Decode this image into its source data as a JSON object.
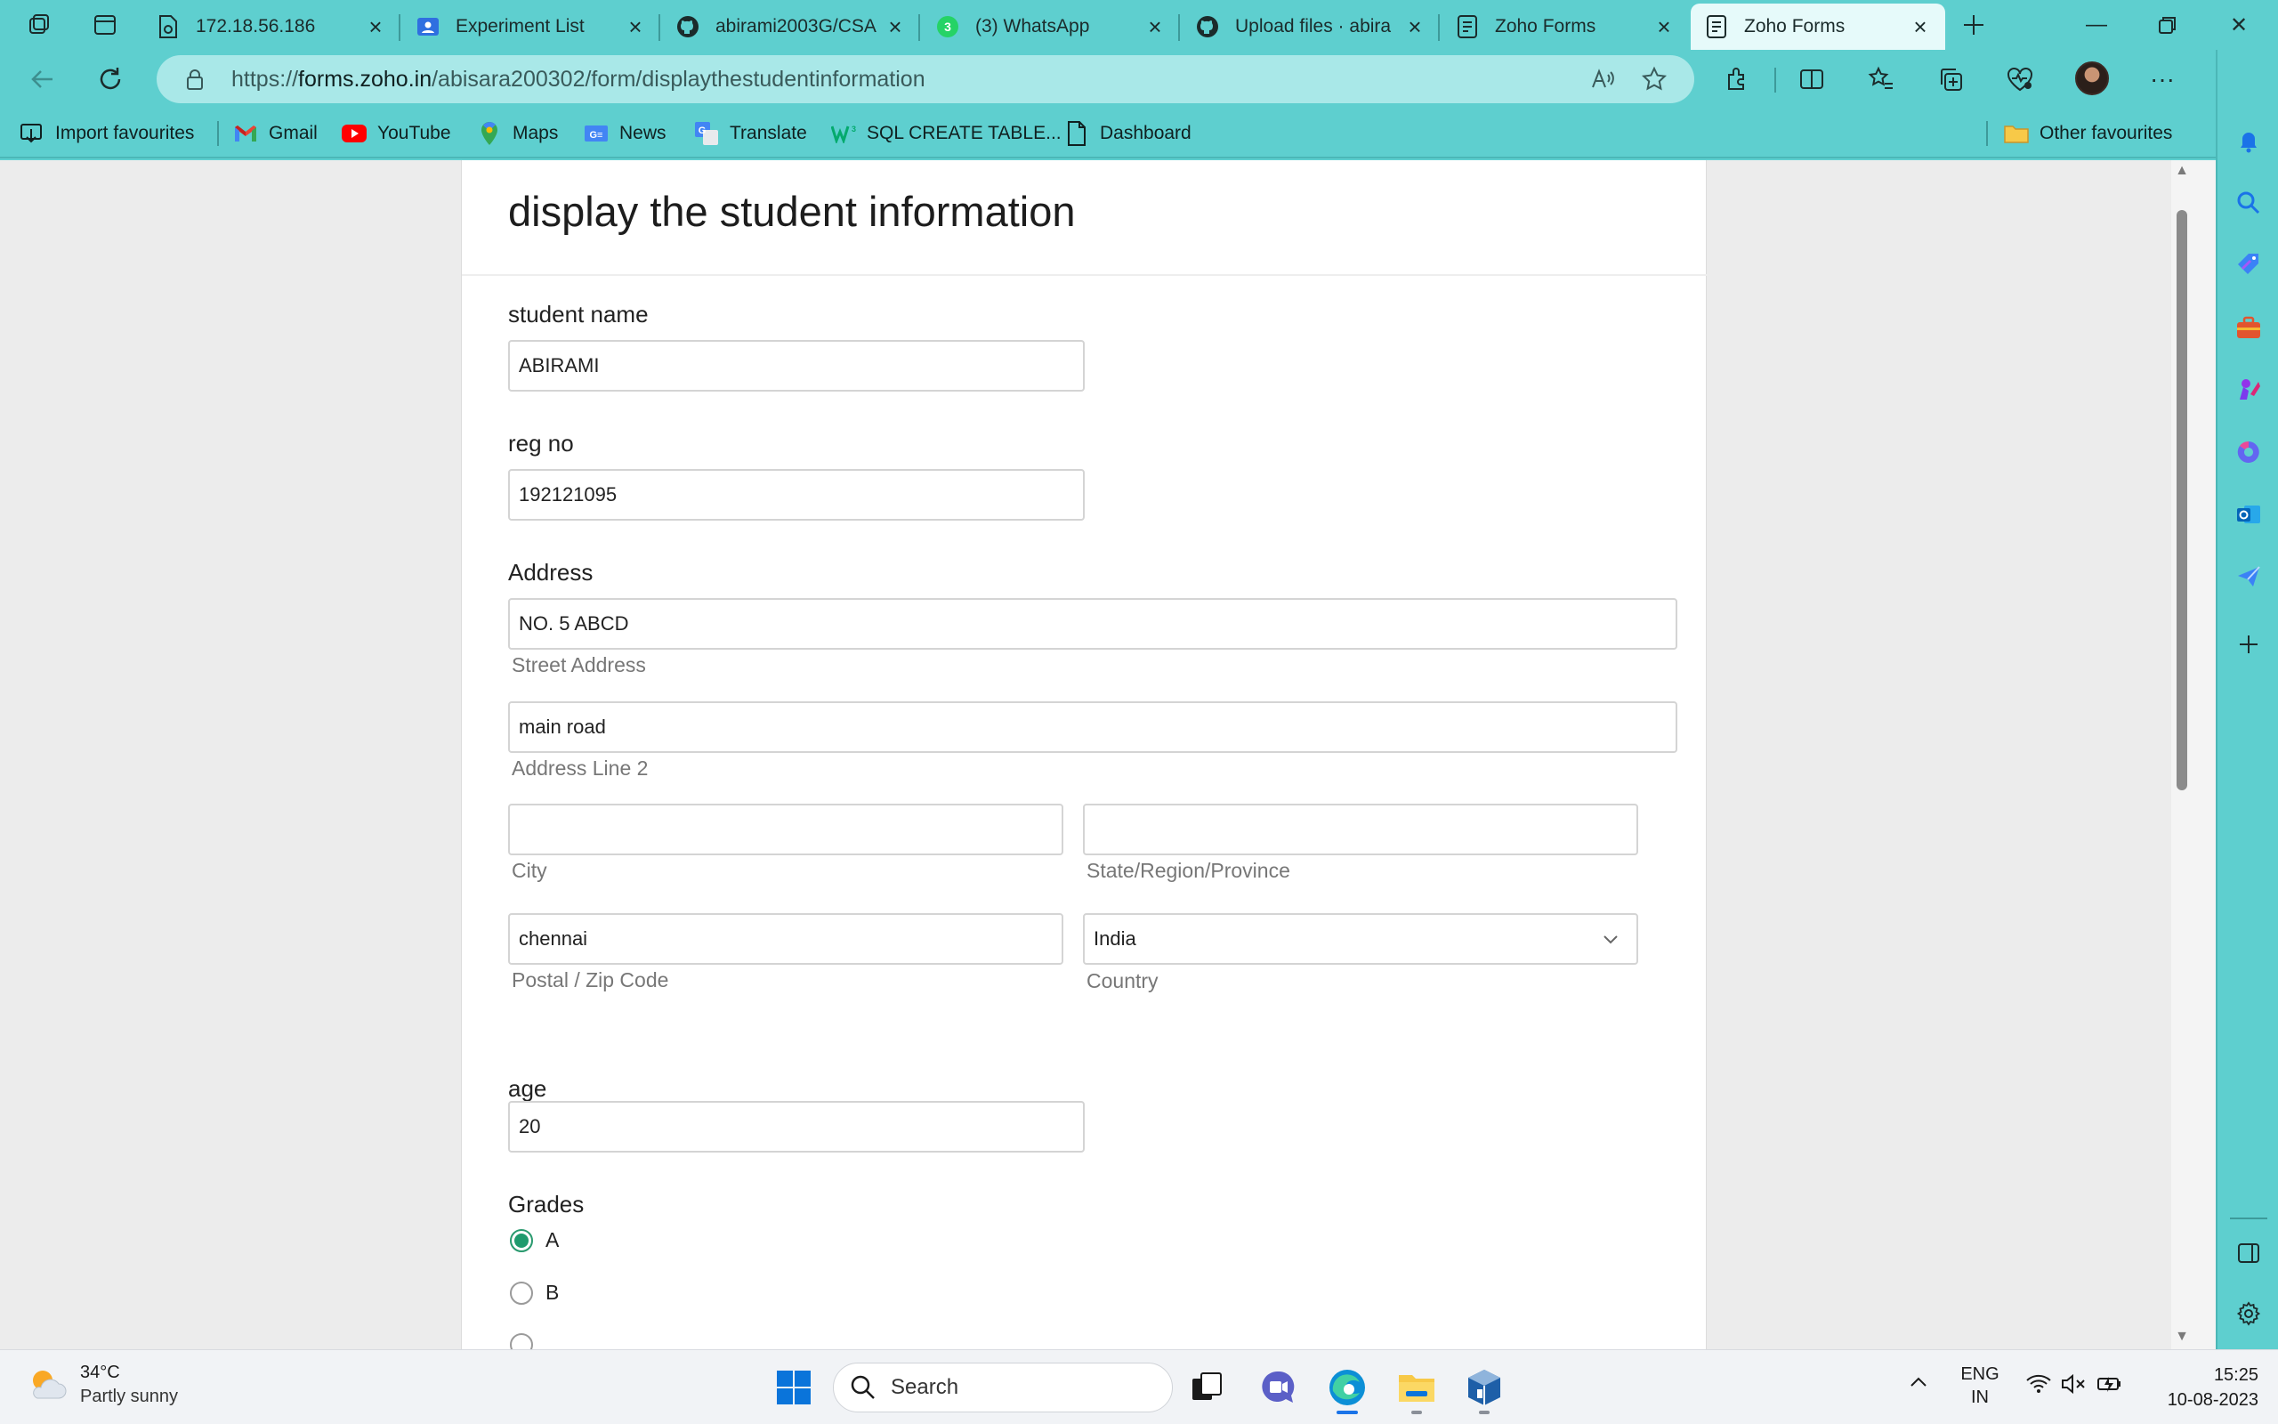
{
  "browser": {
    "tabs": [
      {
        "title": "172.18.56.186",
        "favicon": "document-gear-icon"
      },
      {
        "title": "Experiment List",
        "favicon": "google-classroom-icon"
      },
      {
        "title": "abirami2003G/CSA",
        "favicon": "github-icon"
      },
      {
        "title": "(3) WhatsApp",
        "favicon": "whatsapp-icon"
      },
      {
        "title": "Upload files · abira",
        "favicon": "github-icon"
      },
      {
        "title": "Zoho Forms",
        "favicon": "zoho-forms-icon"
      },
      {
        "title": "Zoho Forms",
        "favicon": "zoho-forms-icon",
        "active": true
      }
    ],
    "url": {
      "prefix": "https://",
      "host": "forms.zoho.in",
      "path": "/abisara200302/form/displaythestudentinformation"
    },
    "favourites": [
      {
        "label": "Import favourites",
        "icon": "import-icon"
      },
      {
        "label": "Gmail",
        "icon": "gmail-icon"
      },
      {
        "label": "YouTube",
        "icon": "youtube-icon"
      },
      {
        "label": "Maps",
        "icon": "maps-icon"
      },
      {
        "label": "News",
        "icon": "news-icon"
      },
      {
        "label": "Translate",
        "icon": "translate-icon"
      },
      {
        "label": "SQL CREATE TABLE...",
        "icon": "w3schools-icon"
      },
      {
        "label": "Dashboard",
        "icon": "page-icon"
      }
    ],
    "other_favourites": "Other favourites",
    "theme_color": "#5ecfcf"
  },
  "form": {
    "title": "display the student information",
    "student_name": {
      "label": "student name",
      "value": "ABIRAMI"
    },
    "reg_no": {
      "label": "reg no",
      "value": "192121095"
    },
    "address": {
      "label": "Address",
      "street": {
        "value": "NO. 5 ABCD",
        "caption": "Street Address"
      },
      "line2": {
        "value": "main road",
        "caption": "Address Line 2"
      },
      "city": {
        "value": "",
        "caption": "City"
      },
      "state": {
        "value": "",
        "caption": "State/Region/Province"
      },
      "postal": {
        "value": "chennai",
        "caption": "Postal / Zip Code"
      },
      "country": {
        "value": "India",
        "caption": "Country"
      }
    },
    "age": {
      "label": "age",
      "value": "20"
    },
    "grades": {
      "label": "Grades",
      "options": [
        {
          "label": "A",
          "selected": true
        },
        {
          "label": "B",
          "selected": false
        }
      ]
    },
    "accent_color": "#1f9a6d"
  },
  "taskbar": {
    "weather": {
      "temp": "34°C",
      "condition": "Partly sunny"
    },
    "search_label": "Search",
    "language": {
      "line1": "ENG",
      "line2": "IN"
    },
    "time": "15:25",
    "date": "10-08-2023"
  }
}
